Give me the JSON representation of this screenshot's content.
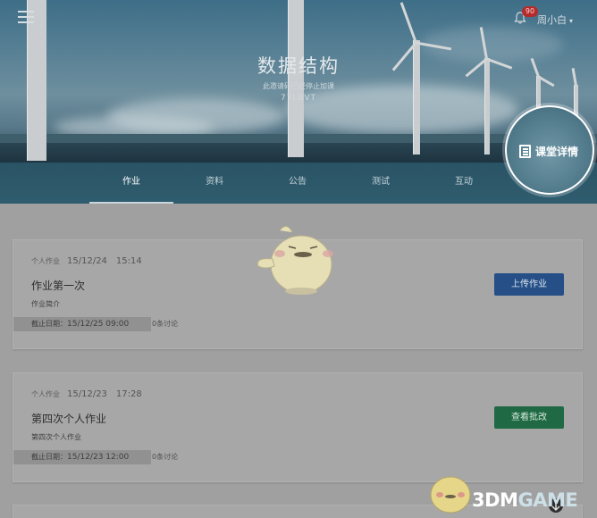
{
  "header": {
    "notification_count": "90",
    "username": "周小白",
    "user_caret": "▾"
  },
  "course": {
    "title": "数据结构",
    "invite_status": "此邀请码已经停止加课",
    "invite_code": "77LBVT"
  },
  "tabs": [
    {
      "label": "作业",
      "active": true
    },
    {
      "label": "资料",
      "active": false
    },
    {
      "label": "公告",
      "active": false
    },
    {
      "label": "测试",
      "active": false
    },
    {
      "label": "互动",
      "active": false
    }
  ],
  "course_detail": {
    "label": "课堂详情",
    "icon": "document-icon"
  },
  "assignments": [
    {
      "type": "个人作业",
      "date": "15/12/24",
      "time": "15:14",
      "title": "作业第一次",
      "description": "作业简介",
      "deadline_label": "截止日期：",
      "deadline_value": "15/12/25  09:00",
      "discussions": "0条讨论",
      "action_label": "上传作业",
      "action_color": "#254f86"
    },
    {
      "type": "个人作业",
      "date": "15/12/23",
      "time": "17:28",
      "title": "第四次个人作业",
      "description": "第四次个人作业",
      "deadline_label": "截止日期：",
      "deadline_value": "15/12/23  12:00",
      "discussions": "0条讨论",
      "action_label": "查看批改",
      "action_color": "#1f6a44"
    }
  ],
  "watermark": {
    "prefix": "3DM",
    "suffix": "GAME"
  },
  "icons": {
    "menu": "hamburger-menu-icon",
    "bell": "bell-icon",
    "caret": "chevron-down-icon"
  }
}
